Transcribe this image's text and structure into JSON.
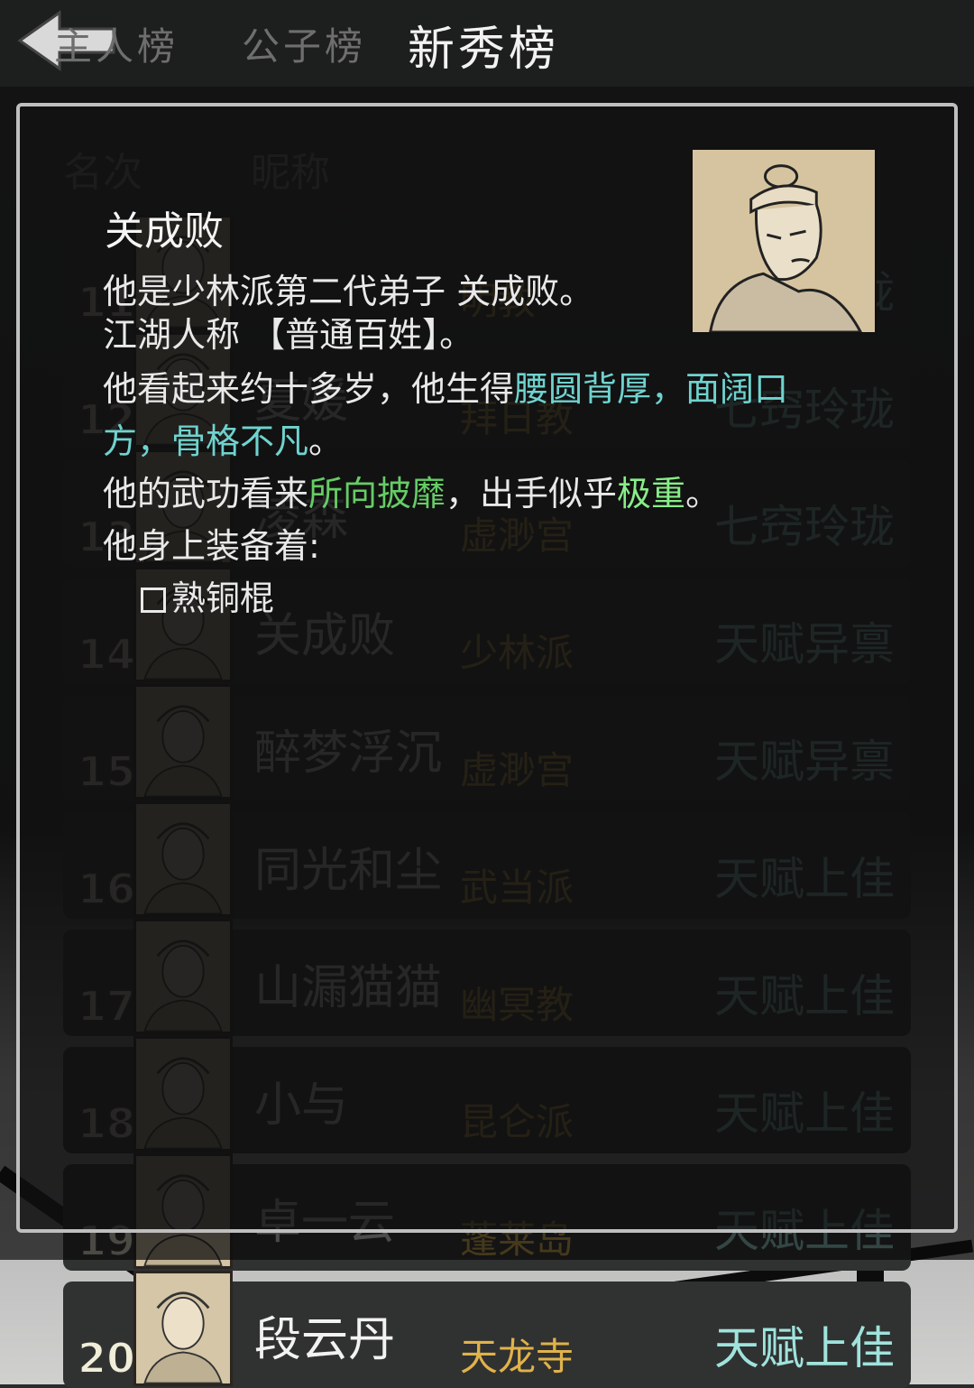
{
  "topbar": {
    "tabs": [
      "主人榜",
      "公子榜",
      "新秀榜"
    ],
    "active_tab": "新秀榜"
  },
  "list": {
    "headers": {
      "rank": "名次",
      "name": "昵称"
    },
    "rows": [
      {
        "rank": "11",
        "name": "",
        "sect": "明教",
        "talent": "七窍玲珑"
      },
      {
        "rank": "12",
        "name": "夏媛",
        "sect": "拜日教",
        "talent": "七窍玲珑"
      },
      {
        "rank": "13",
        "name": "凌森",
        "sect": "虚渺宫",
        "talent": "七窍玲珑"
      },
      {
        "rank": "14",
        "name": "关成败",
        "sect": "少林派",
        "talent": "天赋异禀"
      },
      {
        "rank": "15",
        "name": "醉梦浮沉",
        "sect": "虚渺宫",
        "talent": "天赋异禀"
      },
      {
        "rank": "16",
        "name": "同光和尘",
        "sect": "武当派",
        "talent": "天赋上佳"
      },
      {
        "rank": "17",
        "name": "山漏猫猫",
        "sect": "幽冥教",
        "talent": "天赋上佳"
      },
      {
        "rank": "18",
        "name": "小与",
        "sect": "昆仑派",
        "talent": "天赋上佳"
      },
      {
        "rank": "19",
        "name": "卓一云",
        "sect": "蓬莱岛",
        "talent": "天赋上佳"
      },
      {
        "rank": "20",
        "name": "段云丹",
        "sect": "天龙寺",
        "talent": "天赋上佳"
      }
    ]
  },
  "dialog": {
    "name": "关成败",
    "line1": "他是少林派第二代弟子 关成败。",
    "line2": "江湖人称 【普通百姓】。",
    "line3_a": "他看起来约十多岁，他生得",
    "line3_b": "腰圆背厚",
    "line3_c": "，",
    "line3_d": "面阔口",
    "line4_a": "方，骨格不凡",
    "line4_b": "。",
    "line5_a": "他的武功看来",
    "line5_b": "所向披靡",
    "line5_c": "，出手似乎",
    "line5_d": "极重",
    "line5_e": "。",
    "line6": "他身上装备着:",
    "equipment": "熟铜棍"
  },
  "colors": {
    "cyan": "#6fd3cf",
    "green": "#66cc66",
    "sect": "#e0b24a",
    "talent": "#9fe3dc"
  }
}
